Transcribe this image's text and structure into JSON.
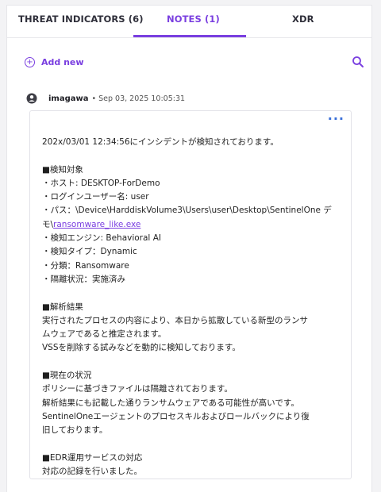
{
  "tabs": [
    {
      "label": "THREAT INDICATORS (6)"
    },
    {
      "label": "NOTES (1)"
    },
    {
      "label": "XDR"
    }
  ],
  "toolbar": {
    "add_label": "Add new"
  },
  "note": {
    "author": "imagawa",
    "meta": "• Sep 03, 2025 10:05:31",
    "lines": {
      "l1": "202x/03/01 12:34:56にインシデントが検知されております。",
      "l2": "■検知対象",
      "l3": "・ホスト: DESKTOP-ForDemo",
      "l4": "・ログインユーザー名: user",
      "l5": "・パス：\\Device\\HarddiskVolume3\\Users\\user\\Desktop\\SentinelOne デ",
      "l6a": "モ\\",
      "l6b": "ransomware_like.exe",
      "l7": "・検知エンジン: Behavioral AI",
      "l8": "・検知タイプ：Dynamic",
      "l9": "・分類：Ransomware",
      "l10": "・隔離状況：実施済み",
      "l11": "■解析結果",
      "l12": "実行されたプロセスの内容により、本日から拡散している新型のランサ",
      "l13": "ムウェアであると推定されます。",
      "l14": "VSSを削除する試みなどを動的に検知しております。",
      "l15": "■現在の状況",
      "l16": "ポリシーに基づきファイルは隔離されております。",
      "l17": "解析結果にも記載した通りランサムウェアである可能性が高いです。",
      "l18": "SentinelOneエージェントのプロセスキルおよびロールバックにより復",
      "l19": "旧しております。",
      "l20": "■EDR運用サービスの対応",
      "l21": "対応の記録を行いました。"
    }
  },
  "colors": {
    "accent": "#7a3fe0",
    "menu": "#3a6fd8"
  },
  "icons": {
    "add": "plus-circle-icon",
    "search": "search-icon",
    "avatar": "user-avatar-icon",
    "more": "more-horizontal-icon"
  }
}
